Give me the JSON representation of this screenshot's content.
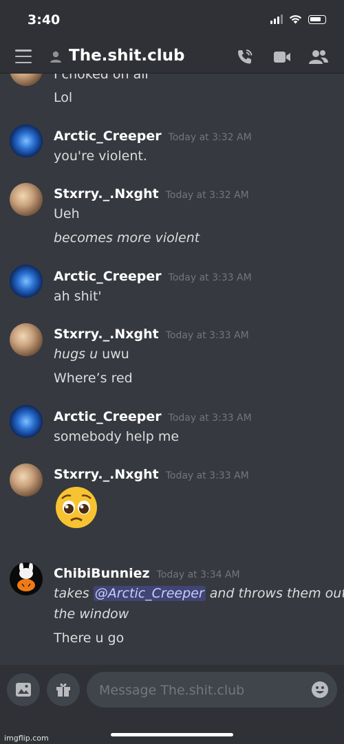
{
  "status_bar": {
    "time": "3:40"
  },
  "header": {
    "channel_name": "The.shit.club"
  },
  "messages": [
    {
      "lines": [
        "I choked on air",
        "Lol"
      ]
    },
    {
      "author": "Arctic_Creeper",
      "time": "Today at 3:32 AM",
      "lines": [
        "you're violent."
      ]
    },
    {
      "author": "Stxrry._.Nxght",
      "time": "Today at 3:32 AM",
      "lines": [
        "Ueh",
        "becomes more violent"
      ]
    },
    {
      "author": "Arctic_Creeper",
      "time": "Today at 3:33 AM",
      "lines": [
        "ah shit'"
      ]
    },
    {
      "author": "Stxrry._.Nxght",
      "time": "Today at 3:33 AM",
      "lines": [
        "hugs u",
        " uwu",
        "Where’s red"
      ]
    },
    {
      "author": "Arctic_Creeper",
      "time": "Today at 3:33 AM",
      "lines": [
        "somebody help me"
      ]
    },
    {
      "author": "Stxrry._.Nxght",
      "time": "Today at 3:33 AM",
      "emoji": "pleading-face"
    },
    {
      "author": "ChibiBunniez",
      "time": "Today at 3:34 AM",
      "lines": [
        "takes ",
        "@Arctic_Creeper",
        " and throws them out",
        "the window",
        "There u go"
      ]
    }
  ],
  "composer": {
    "placeholder": "Message The.shit.club"
  },
  "watermark": "imgflip.com",
  "colors": {
    "background": "#36393f",
    "header": "#2f3136",
    "mention": "#5865f2",
    "timestamp": "#72767d"
  }
}
